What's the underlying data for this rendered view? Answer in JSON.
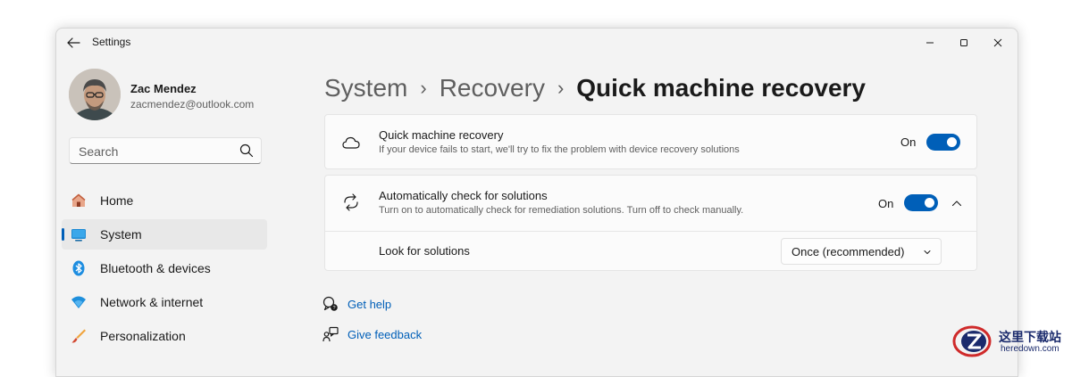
{
  "window": {
    "title": "Settings",
    "controls": [
      "minimize-icon",
      "maximize-icon",
      "close-icon"
    ]
  },
  "user": {
    "name": "Zac Mendez",
    "email": "zacmendez@outlook.com"
  },
  "search": {
    "placeholder": "Search",
    "value": ""
  },
  "sidebar": {
    "items": [
      {
        "label": "Home",
        "icon": "home-icon",
        "active": false
      },
      {
        "label": "System",
        "icon": "system-icon",
        "active": true
      },
      {
        "label": "Bluetooth & devices",
        "icon": "bluetooth-icon",
        "active": false
      },
      {
        "label": "Network & internet",
        "icon": "wifi-icon",
        "active": false
      },
      {
        "label": "Personalization",
        "icon": "brush-icon",
        "active": false
      }
    ]
  },
  "breadcrumb": {
    "items": [
      "System",
      "Recovery",
      "Quick machine recovery"
    ],
    "separator": "›"
  },
  "settings": {
    "quick_recovery": {
      "title": "Quick machine recovery",
      "description": "If your device fails to start, we'll try to fix the problem with device recovery solutions",
      "toggle_label": "On",
      "enabled": true,
      "icon": "cloud-icon"
    },
    "auto_check": {
      "title": "Automatically check for solutions",
      "description": "Turn on to automatically check for remediation solutions. Turn off to check manually.",
      "toggle_label": "On",
      "enabled": true,
      "icon": "refresh-icon",
      "expanded": true,
      "sub_setting": {
        "label": "Look for solutions",
        "selected": "Once (recommended)"
      }
    }
  },
  "links": {
    "help": "Get help",
    "feedback": "Give feedback"
  },
  "watermark": {
    "title": "这里下载站",
    "subtitle": "heredown.com"
  },
  "colors": {
    "accent": "#005fb8",
    "window_bg": "#f3f3f3",
    "card_bg": "#fbfbfb",
    "nav_active_bg": "#e8e8e8"
  }
}
